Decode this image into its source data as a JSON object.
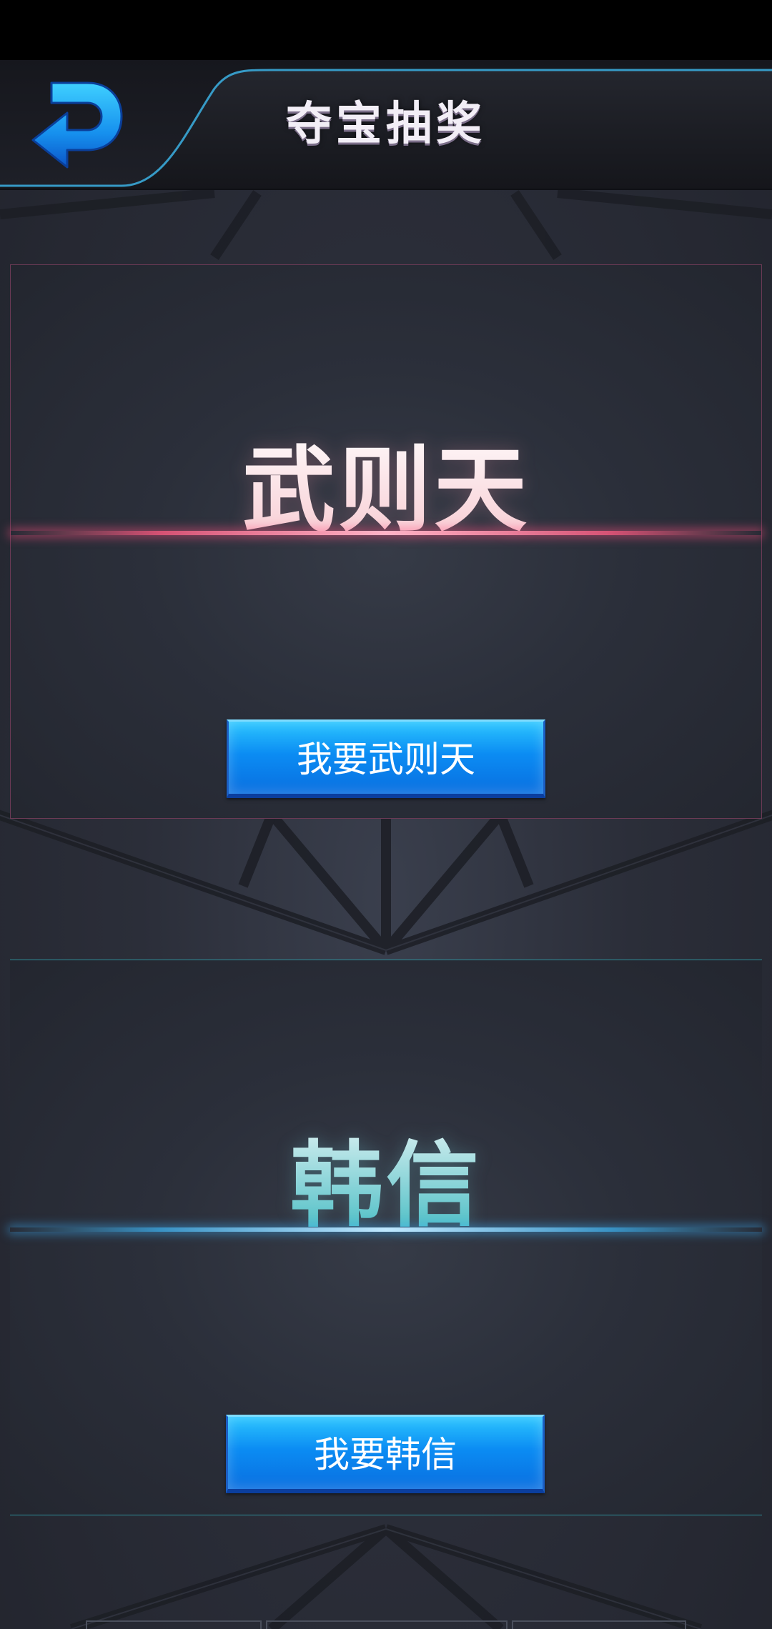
{
  "header": {
    "title": "夺宝抽奖",
    "back_icon": "back-arrow-icon",
    "accent_color": "#2a7fd4"
  },
  "cards": [
    {
      "hero_name": "武则天",
      "button_label": "我要武则天",
      "accent_color": "#ff5a82"
    },
    {
      "hero_name": "韩信",
      "button_label": "我要韩信",
      "accent_color": "#3cc0e0"
    }
  ]
}
